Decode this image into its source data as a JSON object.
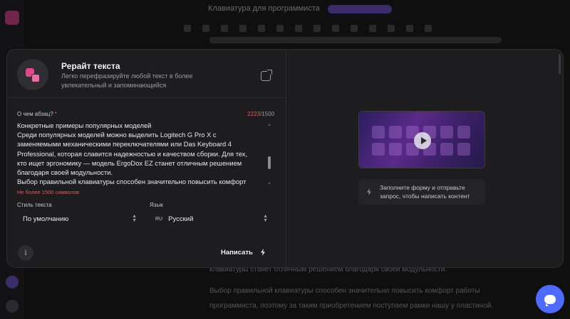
{
  "background": {
    "title": "Клавиатура для программиста",
    "text_lines": [
      "клавиатуры станет отличным решением благодаря своей модульности.",
      "Выбор правильной клавиатуры способен значительно повысить комфорт работы",
      "программиста, поэтому за таким приобретением поступаем рамки нашу у пластиной."
    ]
  },
  "modal": {
    "title": "Рерайт текста",
    "subtitle": "Легко перефразируйте любой текст в более увлекательный и запоминающийся",
    "field_label": "О чем абзац?",
    "required_mark": "*",
    "counter_current": "2223",
    "counter_separator": "/",
    "counter_max": "1500",
    "paragraph_lines": [
      "Конкретные примеры популярных моделей",
      "Среди популярных моделей можно выделить Logitech G Pro X с",
      "заменяемыми механическими переключателями или Das Keyboard 4",
      "Professional, которая славится надежностью и качеством сборки. Для тех,",
      "кто ищет эргономику — модель ErgoDox EZ станет отличным решением",
      "благодаря своей модульности.",
      "Выбор правильной клавиатуры способен значительно повысить комфорт"
    ],
    "error_text": "Не более 1500 символов",
    "style_label": "Стиль текста",
    "style_value": "По умолчанию",
    "language_label": "Язык",
    "language_code": "RU",
    "language_value": "Русский",
    "info_icon_glyph": "i",
    "submit_label": "Написать",
    "hint_text": "Заполните форму и отправьте запрос, чтобы написать контент"
  },
  "colors": {
    "accent_pink": "#e0488a",
    "error_red": "#e05a5a",
    "fab_blue": "#4f6bff"
  },
  "icons": {
    "tool": "rewrite-icon",
    "share": "external-link-icon",
    "info": "info-icon",
    "bolt": "lightning-icon",
    "play": "play-icon",
    "chat": "chat-icon"
  }
}
